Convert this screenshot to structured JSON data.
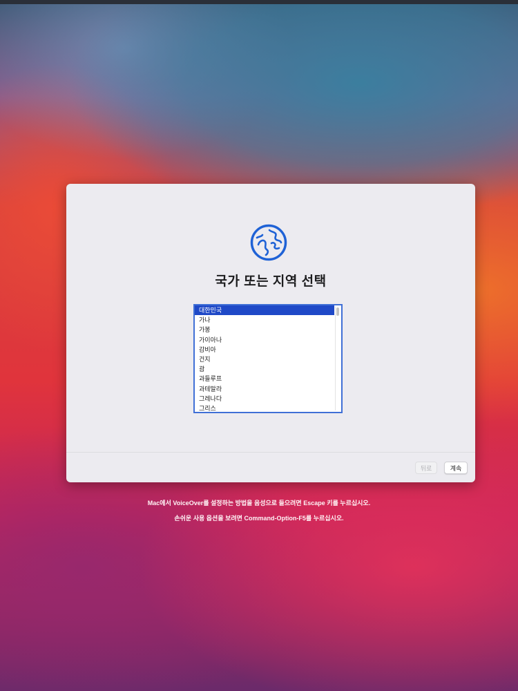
{
  "dialog": {
    "title": "국가 또는 지역 선택",
    "icon": "globe-icon",
    "accent_color": "#1f62d6"
  },
  "country_list": {
    "selected_index": 0,
    "selection_color": "#1f49c7",
    "items": [
      {
        "label": "대한민국"
      },
      {
        "label": "가나"
      },
      {
        "label": "가봉"
      },
      {
        "label": "가이아나"
      },
      {
        "label": "감비아"
      },
      {
        "label": "건지"
      },
      {
        "label": "괌"
      },
      {
        "label": "과들루프"
      },
      {
        "label": "과테말라"
      },
      {
        "label": "그레나다"
      },
      {
        "label": "그리스"
      }
    ]
  },
  "footer": {
    "back_label": "뒤로",
    "continue_label": "계속"
  },
  "hints": {
    "voiceover": "Mac에서 VoiceOver를 설정하는 방법을 음성으로 들으려면 Escape 키를 누르십시오.",
    "accessibility": "손쉬운 사용 옵션을 보려면 Command-Option-F5를 누르십시오."
  }
}
